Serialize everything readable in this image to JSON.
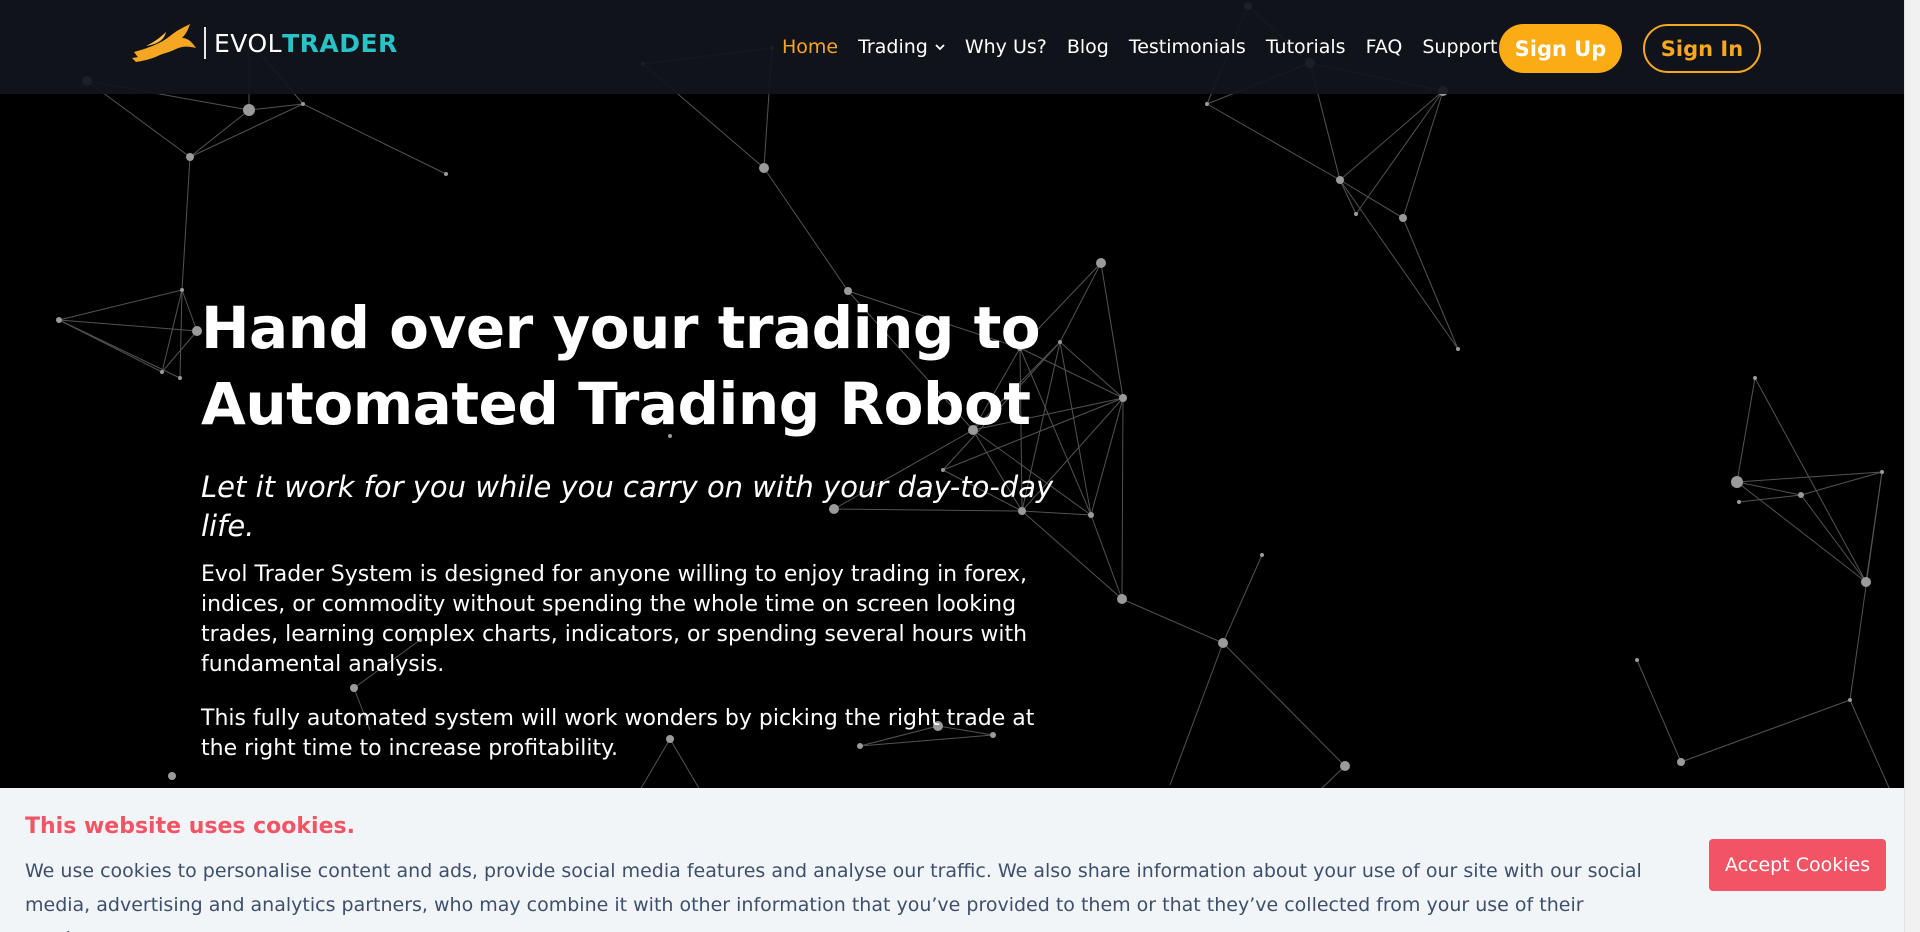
{
  "brand": {
    "name_part1": "EVOL",
    "name_part2": "TRADER",
    "accent_color": "#28c2c7",
    "logo_color": "#f5a623"
  },
  "nav": {
    "items": [
      {
        "label": "Home",
        "active": true
      },
      {
        "label": "Trading",
        "has_dropdown": true
      },
      {
        "label": "Why Us?"
      },
      {
        "label": "Blog"
      },
      {
        "label": "Testimonials"
      },
      {
        "label": "Tutorials"
      },
      {
        "label": "FAQ"
      },
      {
        "label": "Support"
      }
    ],
    "signup_label": "Sign Up",
    "signin_label": "Sign In",
    "accent_color": "#f5a623"
  },
  "hero": {
    "title_line1": "Hand over your trading to",
    "title_line2": "Automated Trading Robot",
    "subtitle": "Let it work for you while you carry on with your day-to-day life.",
    "paragraph1": "Evol Trader System is designed for anyone willing to enjoy trading in forex, indices, or commodity without spending the whole time on screen looking trades, learning complex charts, indicators, or spending several hours with fundamental analysis.",
    "paragraph2": "This fully automated system will work wonders by picking the right trade at the right time to increase profitability."
  },
  "cookie_banner": {
    "title": "This website uses cookies.",
    "text": "We use cookies to personalise content and ads, provide social media features and analyse our traffic. We also share information about your use of our site with our social media, advertising and analytics partners, who may combine it with other information that you’ve provided to them or that they’ve collected from your use of their services.",
    "accept_label": "Accept Cookies",
    "title_color": "#f05465",
    "button_color": "#f25465"
  }
}
